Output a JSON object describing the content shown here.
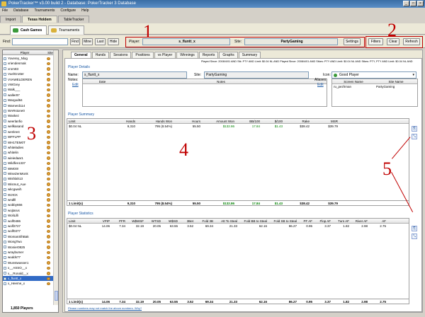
{
  "window": {
    "title": "PokerTracker™ v3.00 build 2 - Database: PokerTracker 3 Database"
  },
  "menu": [
    "File",
    "Database",
    "Tournaments",
    "Configure",
    "Help"
  ],
  "main_tabs": [
    "Import",
    "Texas Holdem",
    "TableTracker"
  ],
  "sub_tabs": [
    "Cash Games",
    "Tournaments"
  ],
  "find": {
    "label": "Find:",
    "value": "",
    "buttons": [
      "Find",
      "Mine",
      "Last",
      "Hide"
    ]
  },
  "player": {
    "label": "Player:",
    "value": "s_fluntt_x"
  },
  "site": {
    "label": "Site:",
    "value": "PartyGaming"
  },
  "settings_label": "Settings",
  "right_buttons": [
    "Filters",
    "Clear",
    "Refresh"
  ],
  "annotations": [
    "1",
    "2",
    "3",
    "4",
    "5"
  ],
  "player_list": {
    "headers": [
      "Player",
      "Site"
    ],
    "players": [
      "Yoverey_Nlog",
      "vriendenmak",
      "vrom83",
      "VuelGrotter",
      "VVAWELDEREN",
      "VWGrey",
      "Walk___",
      "waller87",
      "Wargod84",
      "Warnerd114",
      "WARstone0",
      "Waskez",
      "weerlanfio",
      "wellkasand",
      "wenlee4",
      "WFFLPP",
      "WH1TEM0T",
      "whiteladies",
      "whitelin",
      "wieiedaar1",
      "Wildfire1337",
      "WMO0!",
      "WiseZenMonk",
      "Wishlah13",
      "Wismut_Aue",
      "wkcgweih",
      "WJICK",
      "wndlll",
      "wobby666",
      "wojtarus",
      "WoliLilli",
      "wolf0486",
      "wolf2727",
      "wolf0377",
      "WomanSlhBak",
      "WongTwo",
      "Wonier0825",
      "wraybumer",
      "wudds77",
      "Wunstwasser1",
      "x__ASSO__x",
      "x__Ronald__x",
      "x_fluntt_x",
      "x_Heeme_x"
    ],
    "selected": "x_fluntt_x",
    "count": "1,850 Players"
  },
  "report_tabs": [
    "General",
    "Hands",
    "Sessions",
    "Positions",
    "vs Player",
    "Winnings",
    "Reports",
    "Graphs",
    "Summary"
  ],
  "status_line": "Played Since: 2008/4/01 AND Stk: PTY AND Limit: $0.04 NL AND Played Since: 2008/4/01 AND Stkes: PTY AND Limit: $0.04 NL AND Stkes: PTY, PTY AND Limit: $0.04 NL AND",
  "details": {
    "section": "Player Details",
    "name_label": "Name:",
    "name_value": "s_fluntt_x",
    "site_label": "Site:",
    "site_value": "PartyGaming",
    "icon_label": "Icon:",
    "icon_value": "Good Player",
    "notes_label": "Notes:",
    "edit_label": "Edit",
    "notes_headers": [
      "Date",
      "Notes"
    ],
    "aliases_label": "Aliases:",
    "alias_headers": [
      "Screen Name",
      "Site Name"
    ],
    "aliases": [
      {
        "name": "ru_pezhman",
        "site": "PartyGaming"
      }
    ]
  },
  "summary": {
    "section": "Player Summary",
    "headers": [
      "Limit",
      "Hands",
      "Hands Won",
      "Hours",
      "Amount Won",
      "BB/100",
      "$/100",
      "Rake",
      "MSR"
    ],
    "rows": [
      [
        "$0.04 NL",
        "9,310",
        "795 (8.54%)",
        "55.50",
        "$132.86",
        "17.84",
        "$1.43",
        "$38.42",
        "$39.79"
      ]
    ],
    "total": [
      "1 Limit(s)",
      "9,310",
      "795 (8.54%)",
      "55.50",
      "$132.86",
      "17.84",
      "$1.43",
      "$38.42",
      "$39.79"
    ]
  },
  "statistics": {
    "section": "Player Statistics",
    "headers": [
      "Limit",
      "VPIP",
      "PFR",
      "W$WSF",
      "WTSD",
      "W$SD",
      "3Bet",
      "Fold 3B",
      "Att To Steal",
      "Fold BB to Steal",
      "Fold SB to Steal",
      "PF AF",
      "Flop AF",
      "Turn AF",
      "River AF",
      "AF"
    ],
    "rows": [
      [
        "$0.04 NL",
        "14.06",
        "7.34",
        "32.19",
        "20.05",
        "63.55",
        "3.52",
        "69.34",
        "21.33",
        "62.16",
        "86.27",
        "0.95",
        "3.37",
        "1.82",
        "2.98",
        "2.75"
      ]
    ],
    "total": [
      "1 Limit(s)",
      "14.06",
      "7.34",
      "32.19",
      "20.05",
      "63.55",
      "3.52",
      "69.34",
      "21.33",
      "62.16",
      "86.27",
      "0.95",
      "3.37",
      "1.82",
      "2.98",
      "2.75"
    ],
    "footnote": "Please numbers may not match the above numbers. Why?"
  },
  "colors": {
    "annotation": "#c00000",
    "selection": "#316ac5",
    "section_title": "#1c5aa6",
    "positive": "#008000"
  }
}
